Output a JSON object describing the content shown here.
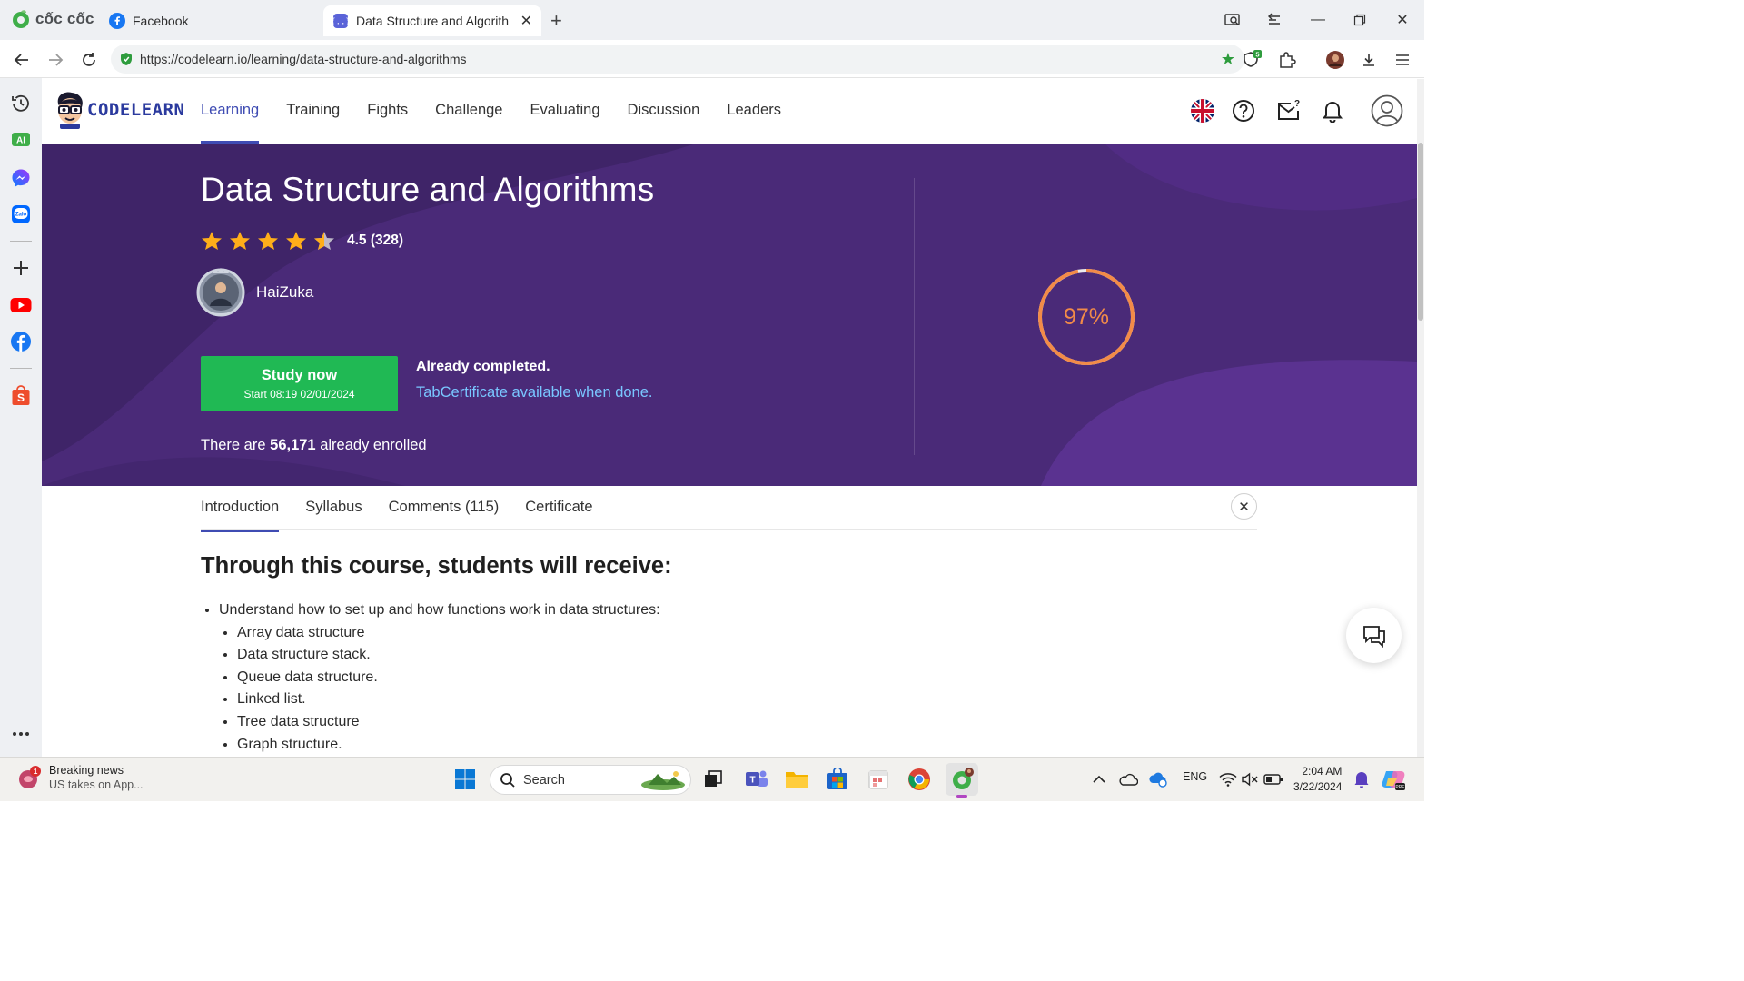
{
  "browser": {
    "brand": "cốc cốc",
    "tabs": [
      {
        "title": "Facebook"
      },
      {
        "title": "Data Structure and Algorithm"
      }
    ],
    "url": "https://codelearn.io/learning/data-structure-and-algorithms",
    "extension_badge": "5"
  },
  "site": {
    "logo_text": "CODELEARN",
    "nav": [
      "Learning",
      "Training",
      "Fights",
      "Challenge",
      "Evaluating",
      "Discussion",
      "Leaders"
    ],
    "active_nav": "Learning",
    "mail_badge": "?"
  },
  "course": {
    "title": "Data Structure and Algorithms",
    "rating": "4.5 (328)",
    "rating_value": 4.5,
    "author": "HaiZuka",
    "study_button": "Study now",
    "study_start": "Start 08:19 02/01/2024",
    "status_text": "Already completed.",
    "certificate_text": "TabCertificate available when done.",
    "enrolled_prefix": "There are",
    "enrolled_count": "56,171",
    "enrolled_suffix": "already enrolled",
    "progress_label": "97%",
    "progress_value": 0.97
  },
  "content_tabs": [
    "Introduction",
    "Syllabus",
    "Comments (115)",
    "Certificate"
  ],
  "intro": {
    "heading": "Through this course, students will receive:",
    "outcomes": [
      {
        "text": "Understand how to set up and how functions work in data structures:",
        "sub": [
          "Array data structure",
          "Data structure stack.",
          "Queue data structure.",
          "Linked list.",
          "Tree data structure",
          "Graph structure."
        ]
      }
    ]
  },
  "taskbar": {
    "news_title": "Breaking news",
    "news_sub": "US takes on App...",
    "news_badge": "1",
    "search_placeholder": "Search",
    "lang": "ENG",
    "time": "2:04 AM",
    "date": "3/22/2024"
  },
  "colors": {
    "hero_bg": "#4a2a78",
    "accent": "#3f4cb3",
    "study_green": "#20b954",
    "progress_orange": "#f28b48",
    "link_blue": "#79c6ff"
  }
}
